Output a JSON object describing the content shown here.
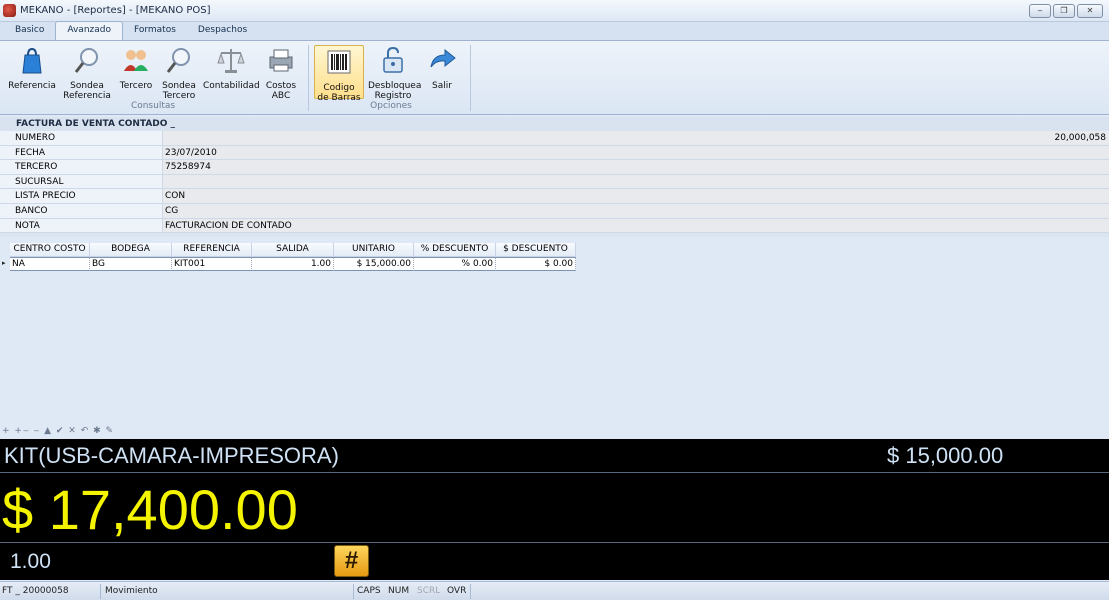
{
  "window": {
    "title": "MEKANO - [Reportes] - [MEKANO POS]",
    "buttons": [
      "‒",
      "❐",
      "✕"
    ]
  },
  "ribbon": {
    "tabs": [
      "Basico",
      "Avanzado",
      "Formatos",
      "Despachos"
    ],
    "active_tab": "Avanzado",
    "groups": [
      {
        "label": "Consultas",
        "buttons": [
          {
            "label1": "Referencia",
            "label2": "",
            "icon": "shopping-bag-icon"
          },
          {
            "label1": "Sondea",
            "label2": "Referencia",
            "icon": "magnifier-icon"
          },
          {
            "label1": "Tercero",
            "label2": "",
            "icon": "people-icon"
          },
          {
            "label1": "Sondea",
            "label2": "Tercero",
            "icon": "magnifier-icon"
          },
          {
            "label1": "Contabilidad",
            "label2": "",
            "icon": "scales-icon"
          },
          {
            "label1": "Costos",
            "label2": "ABC",
            "icon": "printer-icon"
          }
        ]
      },
      {
        "label": "Opciones",
        "buttons": [
          {
            "label1": "Codigo",
            "label2": "de Barras",
            "icon": "barcode-icon"
          },
          {
            "label1": "Desbloquea",
            "label2": "Registro",
            "icon": "unlock-icon"
          },
          {
            "label1": "Salir",
            "label2": "",
            "icon": "exit-arrow-icon"
          }
        ]
      }
    ]
  },
  "form": {
    "header": "FACTURA DE VENTA CONTADO _",
    "rows": [
      {
        "label": "NUMERO",
        "value": "20,000,058",
        "align": "right"
      },
      {
        "label": "FECHA",
        "value": "23/07/2010"
      },
      {
        "label": "TERCERO",
        "value": "75258974"
      },
      {
        "label": "SUCURSAL",
        "value": ""
      },
      {
        "label": "LISTA PRECIO",
        "value": "CON"
      },
      {
        "label": "BANCO",
        "value": "CG"
      },
      {
        "label": "NOTA",
        "value": "FACTURACION DE CONTADO"
      }
    ]
  },
  "grid": {
    "columns": [
      "CENTRO COSTO",
      "BODEGA",
      "REFERENCIA",
      "SALIDA",
      "UNITARIO",
      "% DESCUENTO",
      "$ DESCUENTO"
    ],
    "rows": [
      [
        "NA",
        "BG",
        "KIT001",
        "1.00",
        "$ 15,000.00",
        "% 0.00",
        "$ 0.00"
      ]
    ],
    "row_marker": "▸"
  },
  "navigator": "+ +‒ ‒ ▲ ✔ ✕ ↶ ✱ ✎",
  "pos": {
    "description": "KIT(USB-CAMARA-IMPRESORA)",
    "unit_price": "$ 15,000.00",
    "total": "$ 17,400.00",
    "quantity": "1.00",
    "hash_button": "#"
  },
  "status": {
    "document": "FT _ 20000058",
    "mode": "Movimiento",
    "caps": "CAPS",
    "num": "NUM",
    "scrl": "SCRL",
    "ovr": "OVR"
  },
  "colors": {
    "pos_background": "#000000",
    "total_color": "#f4f400",
    "pos_text": "#cfe2f5",
    "ribbon_selected": "#ffdf8c"
  }
}
